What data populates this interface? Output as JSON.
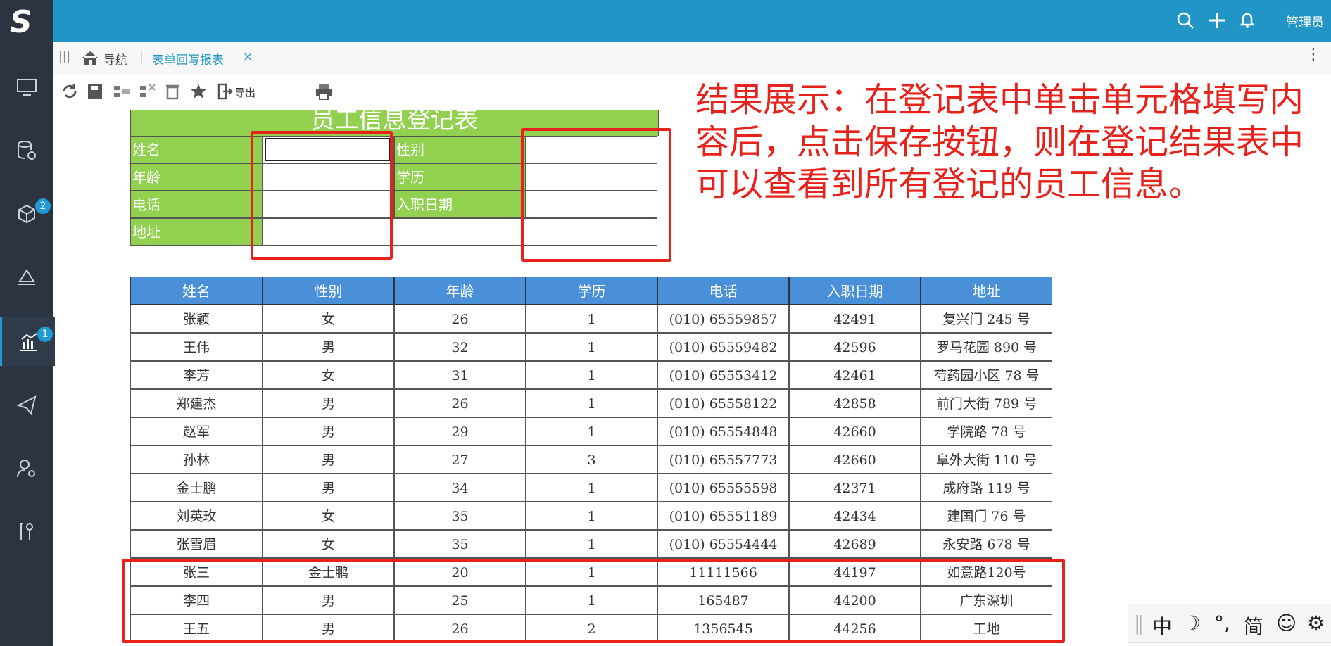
{
  "topbar": {
    "admin_label": "管理员"
  },
  "sidebar": {
    "badges": {
      "cube": "2",
      "report": "1"
    }
  },
  "tabs": {
    "nav_label": "导航",
    "active_tab": "表单回写报表"
  },
  "toolbar": {
    "export_label": "导出"
  },
  "form": {
    "title": "员工信息登记表",
    "labels": {
      "name": "姓名",
      "gender": "性别",
      "age": "年龄",
      "education": "学历",
      "phone": "电话",
      "hire_date": "入职日期",
      "address": "地址"
    }
  },
  "table": {
    "headers": [
      "姓名",
      "性别",
      "年龄",
      "学历",
      "电话",
      "入职日期",
      "地址"
    ],
    "rows": [
      [
        "张颖",
        "女",
        "26",
        "1",
        "(010) 65559857",
        "42491",
        "复兴门 245 号"
      ],
      [
        "王伟",
        "男",
        "32",
        "1",
        "(010) 65559482",
        "42596",
        "罗马花园 890 号"
      ],
      [
        "李芳",
        "女",
        "31",
        "1",
        "(010) 65553412",
        "42461",
        "芍药园小区 78 号"
      ],
      [
        "郑建杰",
        "男",
        "26",
        "1",
        "(010) 65558122",
        "42858",
        "前门大街 789 号"
      ],
      [
        "赵军",
        "男",
        "29",
        "1",
        "(010) 65554848",
        "42660",
        "学院路 78 号"
      ],
      [
        "孙林",
        "男",
        "27",
        "3",
        "(010) 65557773",
        "42660",
        "阜外大街 110 号"
      ],
      [
        "金士鹏",
        "男",
        "34",
        "1",
        "(010) 65555598",
        "42371",
        "成府路 119 号"
      ],
      [
        "刘英玫",
        "女",
        "35",
        "1",
        "(010) 65551189",
        "42434",
        "建国门 76 号"
      ],
      [
        "张雪眉",
        "女",
        "35",
        "1",
        "(010) 65554444",
        "42689",
        "永安路 678 号"
      ],
      [
        "张三",
        "金士鹏",
        "20",
        "1",
        "11111566",
        "44197",
        "如意路120号"
      ],
      [
        "李四",
        "男",
        "25",
        "1",
        "165487",
        "44200",
        "广东深圳"
      ],
      [
        "王五",
        "男",
        "26",
        "2",
        "1356545",
        "44256",
        "工地"
      ]
    ]
  },
  "annotation": {
    "text": "结果展示：在登记表中单击单元格填写内容后，点击保存按钮，则在登记结果表中可以查看到所有登记的员工信息。"
  },
  "ime": {
    "items": [
      "中",
      "☽",
      "°,",
      "简",
      "☺",
      "⚙"
    ]
  },
  "colors": {
    "sidebar": "#2b3440",
    "topbar": "#2196c6",
    "form_green": "#92d050",
    "header_blue": "#4a90d9",
    "annotation_red": "#e8211a"
  }
}
